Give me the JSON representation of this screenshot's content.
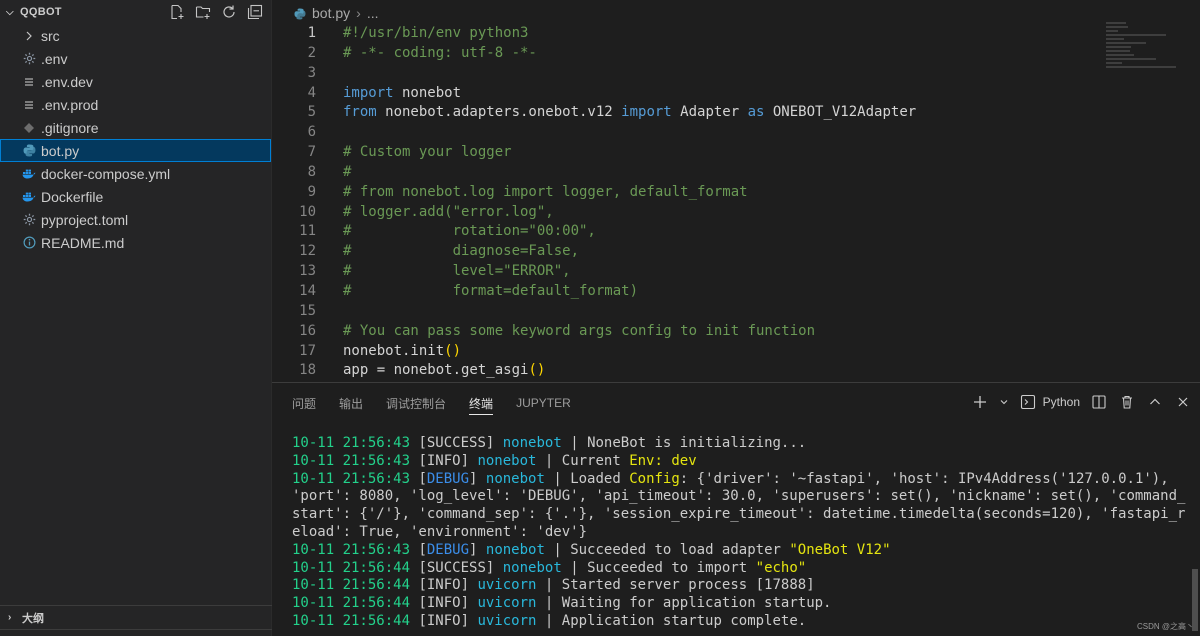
{
  "explorer": {
    "title": "QQBOT",
    "items": [
      {
        "label": "src",
        "icon": "chevron-right-icon",
        "kind": "folder"
      },
      {
        "label": ".env",
        "icon": "gear-icon",
        "kind": "file"
      },
      {
        "label": ".env.dev",
        "icon": "lines-icon",
        "kind": "file"
      },
      {
        "label": ".env.prod",
        "icon": "lines-icon",
        "kind": "file"
      },
      {
        "label": ".gitignore",
        "icon": "git-icon",
        "kind": "file"
      },
      {
        "label": "bot.py",
        "icon": "python-icon",
        "kind": "file",
        "selected": true
      },
      {
        "label": "docker-compose.yml",
        "icon": "docker-icon",
        "kind": "file"
      },
      {
        "label": "Dockerfile",
        "icon": "docker-icon",
        "kind": "file"
      },
      {
        "label": "pyproject.toml",
        "icon": "gear-icon",
        "kind": "file"
      },
      {
        "label": "README.md",
        "icon": "info-icon",
        "kind": "file"
      }
    ],
    "outline_label": "大纲"
  },
  "editor": {
    "breadcrumb_file": "bot.py",
    "breadcrumb_more": "...",
    "lines": [
      {
        "n": "1",
        "text": "#!/usr/bin/env python3"
      },
      {
        "n": "2",
        "text": "# -*- coding: utf-8 -*-"
      },
      {
        "n": "3",
        "text": ""
      },
      {
        "n": "4",
        "text": "import nonebot"
      },
      {
        "n": "5",
        "text": "from nonebot.adapters.onebot.v12 import Adapter as ONEBOT_V12Adapter"
      },
      {
        "n": "6",
        "text": ""
      },
      {
        "n": "7",
        "text": "# Custom your logger"
      },
      {
        "n": "8",
        "text": "#"
      },
      {
        "n": "9",
        "text": "# from nonebot.log import logger, default_format"
      },
      {
        "n": "10",
        "text": "# logger.add(\"error.log\","
      },
      {
        "n": "11",
        "text": "#            rotation=\"00:00\","
      },
      {
        "n": "12",
        "text": "#            diagnose=False,"
      },
      {
        "n": "13",
        "text": "#            level=\"ERROR\","
      },
      {
        "n": "14",
        "text": "#            format=default_format)"
      },
      {
        "n": "15",
        "text": ""
      },
      {
        "n": "16",
        "text": "# You can pass some keyword args config to init function"
      },
      {
        "n": "17",
        "text": "nonebot.init()"
      },
      {
        "n": "18",
        "text": "app = nonebot.get_asgi()"
      }
    ]
  },
  "panel": {
    "tabs": [
      "问题",
      "输出",
      "调试控制台",
      "终端",
      "JUPYTER"
    ],
    "active_tab": "终端",
    "terminal_profile": "Python",
    "terminal_lines": [
      {
        "ts": "10-11 21:56:43",
        "level": "SUCCESS",
        "module": "nonebot",
        "msg": "NoneBot is initializing..."
      },
      {
        "ts": "10-11 21:56:43",
        "level": "INFO",
        "module": "nonebot",
        "msg_pre": "Current ",
        "msg_hl": "Env: dev",
        "msg_post": ""
      },
      {
        "ts": "10-11 21:56:43",
        "level": "DEBUG",
        "module": "nonebot",
        "msg_pre": "Loaded ",
        "msg_hl": "Config",
        "msg_post": ": {'driver': '~fastapi', 'host': IPv4Address('127.0.0.1'), 'port': 8080, 'log_level': 'DEBUG', 'api_timeout': 30.0, 'superusers': set(), 'nickname': set(), 'command_start': {'/'}, 'command_sep': {'.'}, 'session_expire_timeout': datetime.timedelta(seconds=120), 'fastapi_reload': True, 'environment': 'dev'}"
      },
      {
        "ts": "10-11 21:56:43",
        "level": "DEBUG",
        "module": "nonebot",
        "msg_pre": "Succeeded to load adapter ",
        "msg_hl": "\"OneBot V12\"",
        "msg_post": ""
      },
      {
        "ts": "10-11 21:56:44",
        "level": "SUCCESS",
        "module": "nonebot",
        "msg_pre": "Succeeded to import ",
        "msg_hl": "\"echo\"",
        "msg_post": ""
      },
      {
        "ts": "10-11 21:56:44",
        "level": "INFO",
        "module": "uvicorn",
        "msg": "Started server process [17888]"
      },
      {
        "ts": "10-11 21:56:44",
        "level": "INFO",
        "module": "uvicorn",
        "msg": "Waiting for application startup."
      },
      {
        "ts": "10-11 21:56:44",
        "level": "INFO",
        "module": "uvicorn",
        "msg": "Application startup complete."
      }
    ]
  },
  "watermark": "CSDN @之高丶",
  "colors": {
    "selection_bg": "#04395e",
    "selection_border": "#007fd4",
    "timestamp": "#23d18b",
    "debug": "#3b8eea",
    "module": "#29b8db",
    "highlight": "#e5e510"
  }
}
